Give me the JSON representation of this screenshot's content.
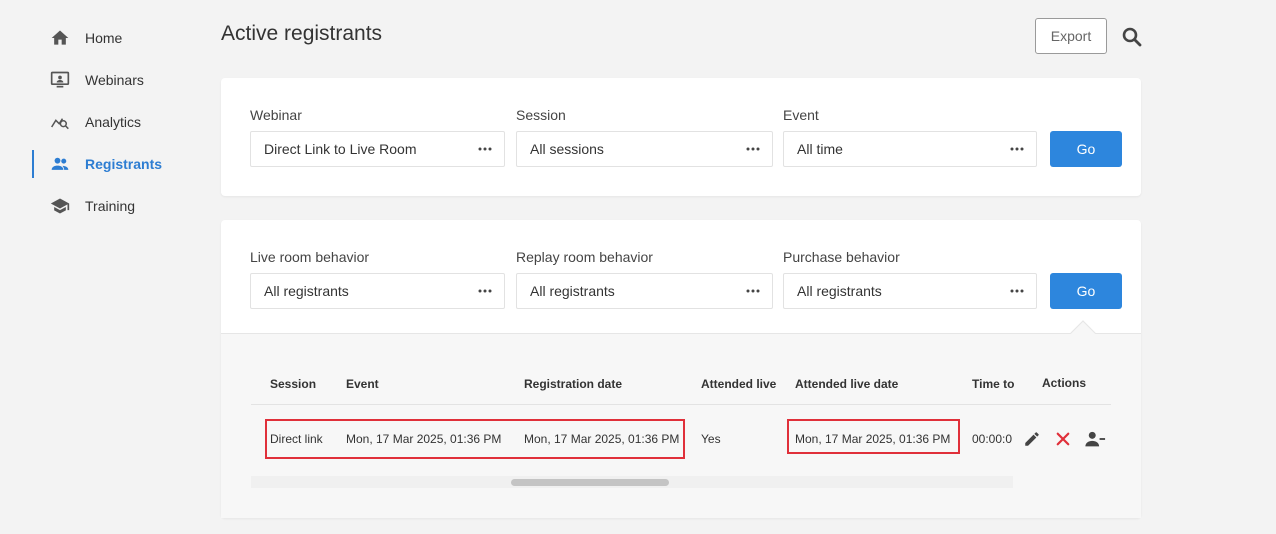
{
  "sidebar": {
    "items": [
      {
        "label": "Home",
        "icon": "home-icon"
      },
      {
        "label": "Webinars",
        "icon": "webinar-icon"
      },
      {
        "label": "Analytics",
        "icon": "analytics-icon"
      },
      {
        "label": "Registrants",
        "icon": "people-icon",
        "active": true
      },
      {
        "label": "Training",
        "icon": "graduation-cap-icon"
      }
    ]
  },
  "header": {
    "title": "Active registrants",
    "export_label": "Export"
  },
  "filters1": {
    "webinar": {
      "label": "Webinar",
      "value": "Direct Link to Live Room"
    },
    "session": {
      "label": "Session",
      "value": "All sessions"
    },
    "event": {
      "label": "Event",
      "value": "All time"
    },
    "go_label": "Go"
  },
  "filters2": {
    "live": {
      "label": "Live room behavior",
      "value": "All registrants"
    },
    "replay": {
      "label": "Replay room behavior",
      "value": "All registrants"
    },
    "purchase": {
      "label": "Purchase behavior",
      "value": "All registrants"
    },
    "go_label": "Go"
  },
  "table": {
    "headers": [
      "Session",
      "Event",
      "Registration date",
      "Attended live",
      "Attended live date",
      "Time to",
      "Actions"
    ],
    "rows": [
      {
        "session": "Direct link",
        "event": "Mon, 17 Mar 2025, 01:36 PM",
        "registration_date": "Mon, 17 Mar 2025, 01:36 PM",
        "attended_live": "Yes",
        "attended_live_date": "Mon, 17 Mar 2025, 01:36 PM",
        "time_to": "00:00:0"
      }
    ]
  },
  "colors": {
    "accent": "#2d7dd2",
    "button": "#2d86dd",
    "highlight": "#e0303a",
    "delete": "#e0303a"
  }
}
